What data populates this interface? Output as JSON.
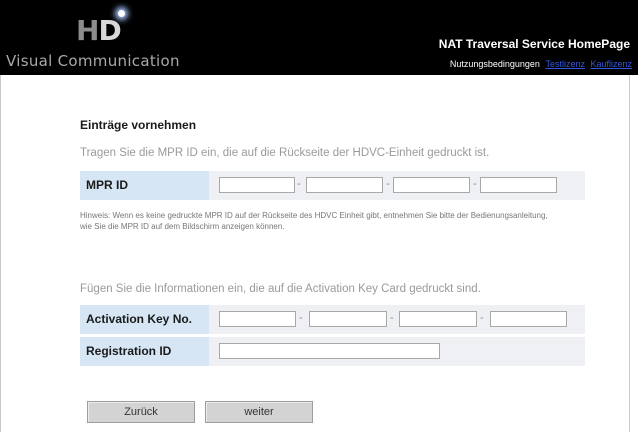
{
  "header": {
    "logo_mark": "HD",
    "logo_text": "Visual Communication",
    "site_title": "NAT Traversal Service HomePage",
    "links": [
      "Nutzungsbedingungen",
      "Testlizenz",
      "Kauflizenz"
    ]
  },
  "main": {
    "heading": "Einträge vornehmen",
    "mpr_instruction": "Tragen Sie die MPR ID ein, die auf die Rückseite der HDVC-Einheit gedruckt ist.",
    "mpr_label": "MPR ID",
    "separator": "-",
    "hint": "Hinweis: Wenn es keine gedruckte MPR ID auf der Rückseite des HDVC Einheit gibt, entnehmen Sie bitte der Bedienungsanleitung, wie Sie die MPR ID auf dem Bildschirm anzeigen können.",
    "card_instruction": "Fügen Sie die Informationen ein, die auf die Activation Key Card gedruckt sind.",
    "activation_label": "Activation Key No.",
    "registration_label": "Registration ID"
  },
  "buttons": {
    "back": "Zurück",
    "next": "weiter"
  }
}
